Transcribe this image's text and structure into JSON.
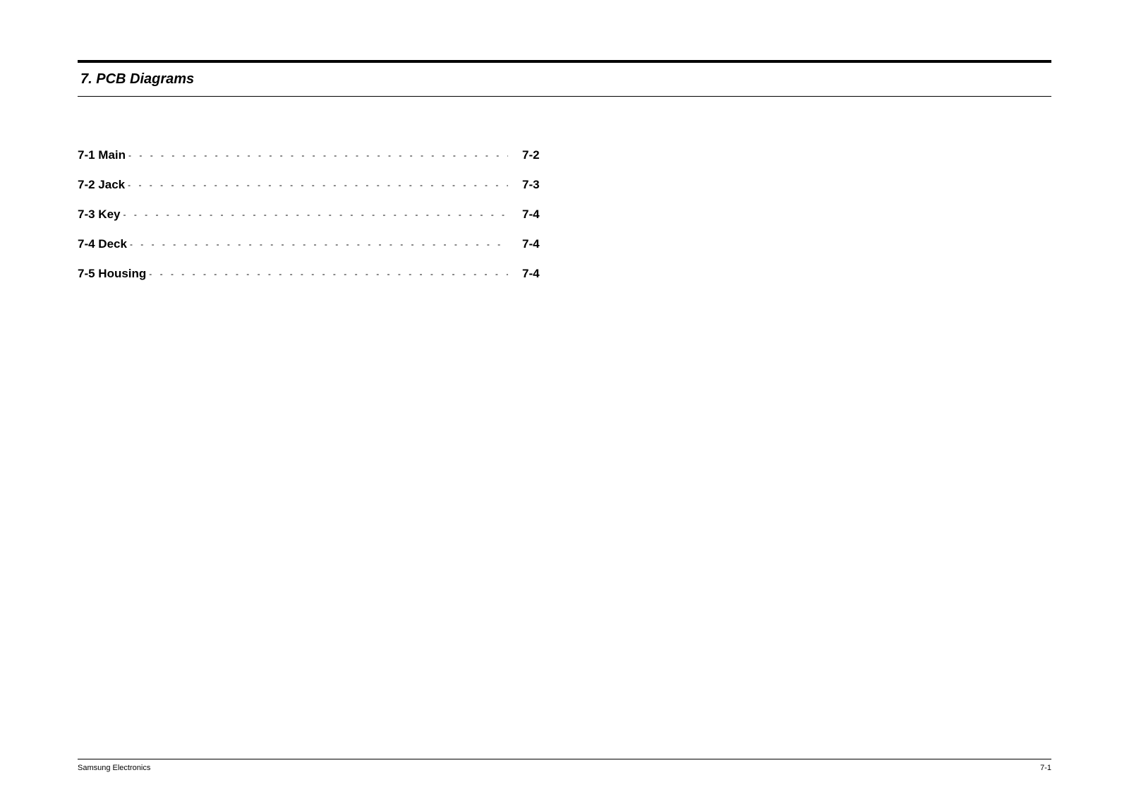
{
  "section": {
    "heading": "7. PCB Diagrams"
  },
  "toc": {
    "items": [
      {
        "label": "7-1  Main",
        "page": "7-2"
      },
      {
        "label": "7-2  Jack",
        "page": "7-3"
      },
      {
        "label": "7-3  Key",
        "page": "7-4"
      },
      {
        "label": "7-4  Deck",
        "page": "7-4"
      },
      {
        "label": "7-5  Housing",
        "page": "7-4"
      }
    ]
  },
  "footer": {
    "left": "Samsung Electronics",
    "right": "7-1"
  }
}
